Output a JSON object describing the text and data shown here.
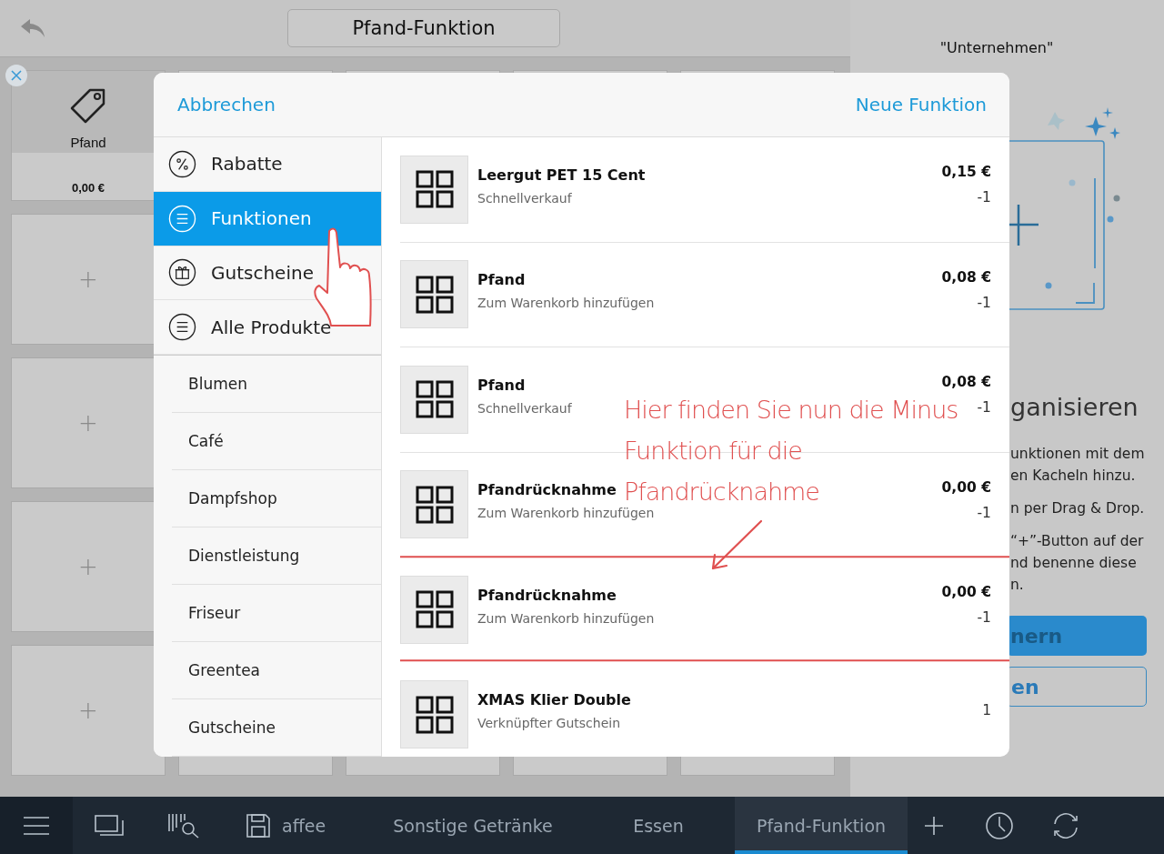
{
  "top_bar": {
    "title": "Pfand-Funktion"
  },
  "tiles": [
    {
      "kind": "product",
      "name": "Pfand",
      "price": "0,00 €",
      "removable": true
    },
    {
      "kind": "add",
      "label": "+",
      "removable": false
    },
    {
      "kind": "add",
      "label": "+",
      "removable": false
    },
    {
      "kind": "add",
      "label": "+",
      "removable": false
    },
    {
      "kind": "add",
      "label": "+",
      "removable": false
    }
  ],
  "info_panel": {
    "heading": "\"Unternehmen\"",
    "title": "ganisieren",
    "paragraphs": [
      [
        "unktionen mit dem",
        "en Kacheln hinzu."
      ],
      [
        "n per Drag & Drop."
      ],
      [
        "“+”-Button auf der",
        "nd benenne diese",
        "n."
      ]
    ],
    "buttons": [
      {
        "label": "nern",
        "kind": "primary"
      },
      {
        "label": "en",
        "kind": "secondary"
      }
    ]
  },
  "modal": {
    "cancel": "Abbrechen",
    "action": "Neue Funktion",
    "categories": [
      {
        "label": "Rabatte",
        "kind": "percent",
        "selected": false
      },
      {
        "label": "Funktionen",
        "kind": "list",
        "selected": true
      },
      {
        "label": "Gutscheine",
        "kind": "gift",
        "selected": false
      },
      {
        "label": "Alle Produkte",
        "kind": "list",
        "selected": false
      }
    ],
    "groups": [
      "Blumen",
      "Café",
      "Dampfshop",
      "Dienstleistung",
      "Friseur",
      "Greentea",
      "Gutscheine"
    ],
    "items": [
      {
        "name": "Leergut PET 15 Cent",
        "subtitle": "Schnellverkauf",
        "price": "0,15 €",
        "quantity": "-1",
        "highlighted": false
      },
      {
        "name": "Pfand",
        "subtitle": "Zum Warenkorb hinzufügen",
        "price": "0,08 €",
        "quantity": "-1",
        "highlighted": false
      },
      {
        "name": "Pfand",
        "subtitle": "Schnellverkauf",
        "price": "0,08 €",
        "quantity": "-1",
        "highlighted": false
      },
      {
        "name": "Pfandrücknahme",
        "subtitle": "Zum Warenkorb hinzufügen",
        "price": "0,00 €",
        "quantity": "-1",
        "highlighted": false
      },
      {
        "name": "Pfandrücknahme",
        "subtitle": "Zum Warenkorb hinzufügen",
        "price": "0,00 €",
        "quantity": "-1",
        "highlighted": true
      },
      {
        "name": "XMAS Klier Double",
        "subtitle": "Verknüpfter Gutschein",
        "quantity": "1",
        "highlighted": false
      }
    ]
  },
  "annotation": {
    "lines": [
      "Hier finden Sie nun die Minus",
      "Funktion für die",
      "Pfandrücknahme"
    ]
  },
  "bottom_bar": {
    "tabs": [
      {
        "label": "affee",
        "selected": false
      },
      {
        "label": "Sonstige Getränke",
        "selected": false
      },
      {
        "label": "Essen",
        "selected": false
      },
      {
        "label": "Pfand-Funktion",
        "selected": true
      }
    ]
  }
}
